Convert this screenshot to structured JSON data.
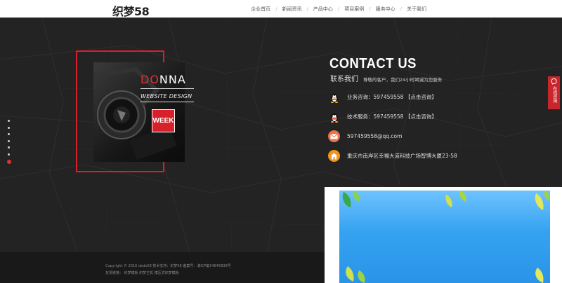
{
  "header": {
    "logo": "织梦58",
    "nav": [
      {
        "label": "企业首页"
      },
      {
        "label": "新闻资讯"
      },
      {
        "label": "产品中心"
      },
      {
        "label": "项目案例"
      },
      {
        "label": "服务中心"
      },
      {
        "label": "关于我们"
      }
    ],
    "separator": "/"
  },
  "poster": {
    "title_red": "DO",
    "title_white": "NNA",
    "subtitle": "WEBSITE DESIGN",
    "badge": "WEEK"
  },
  "contact": {
    "title": "CONTACT US",
    "subtitle_cn": "联系我们",
    "tagline": "尊敬的客户，我们24小时竭诚为您服务",
    "items": [
      {
        "icon": "qq-penguin-icon",
        "text": "业务咨询：597459558 【点击咨询】"
      },
      {
        "icon": "qq-penguin-icon",
        "text": "技术服务：597459558 【点击咨询】"
      },
      {
        "icon": "mail-icon",
        "text": "597459558@qq.com"
      },
      {
        "icon": "home-icon",
        "text": "重庆市南岸区幸福大道科技广场智博大厦23-58"
      }
    ]
  },
  "online_tab": {
    "label": "在线咨询"
  },
  "footer": {
    "line1": "Copyright © 2016 dede58 技术支持：织梦58 备案号：滇ICP备54845838号",
    "line2": "友情链接： 织梦模板 织梦主机 模压式织梦模板"
  },
  "colors": {
    "accent_red": "#d8202a",
    "dark_bg": "#232323",
    "ad_blue": "#35a2f0",
    "mail_orange": "#e9734a",
    "home_orange": "#f2941d"
  }
}
